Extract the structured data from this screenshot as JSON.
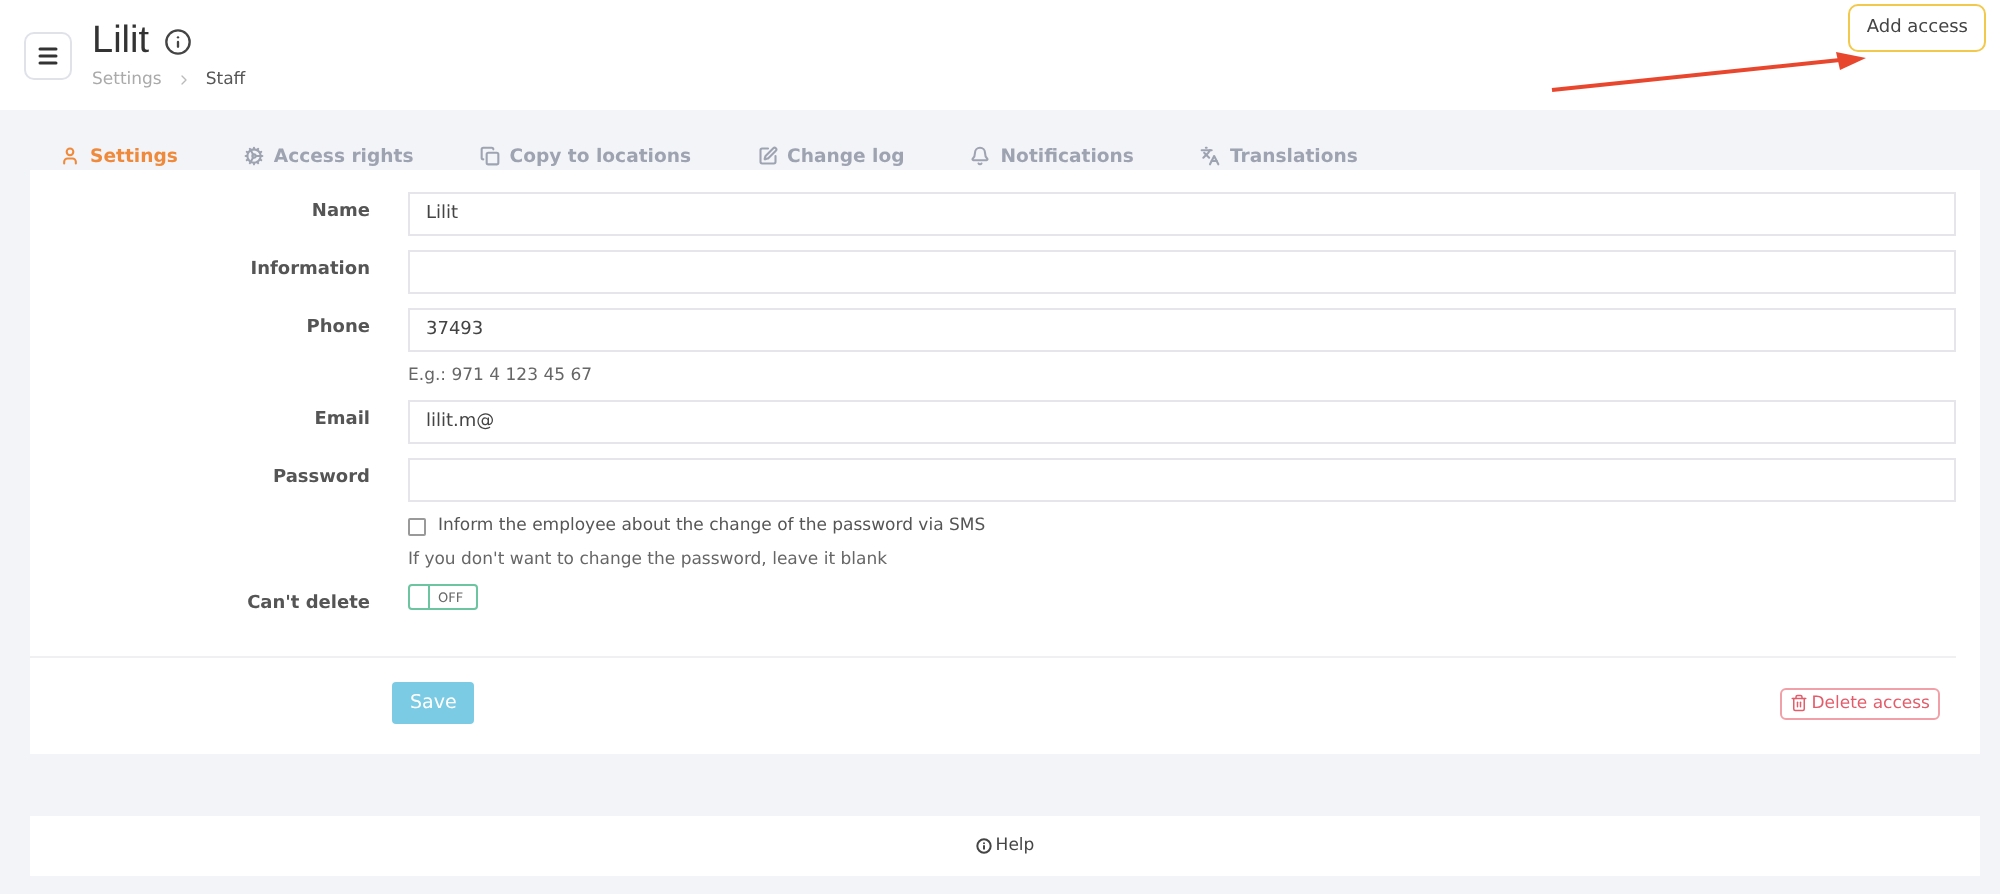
{
  "header": {
    "title": "Lilit",
    "breadcrumbs": [
      {
        "label": "Settings",
        "current": false
      },
      {
        "label": "Staff",
        "current": true
      }
    ],
    "add_button": "Add access"
  },
  "tabs": [
    {
      "label": "Settings",
      "selected": true
    },
    {
      "label": "Access rights",
      "selected": false
    },
    {
      "label": "Copy to locations",
      "selected": false
    },
    {
      "label": "Change log",
      "selected": false
    },
    {
      "label": "Notifications",
      "selected": false
    },
    {
      "label": "Translations",
      "selected": false
    }
  ],
  "form": {
    "fields": [
      {
        "label": "Name",
        "kind": "input",
        "value": "Lilit"
      },
      {
        "label": "Information",
        "kind": "input"
      },
      {
        "label": "Phone",
        "kind": "input",
        "value": "37493",
        "hint": "E.g.: 971 4 123 45 67"
      },
      {
        "label": "Email",
        "kind": "input",
        "value": "lilit.m@"
      },
      {
        "label": "Password",
        "kind": "input",
        "checkbox": {
          "label": "Inform the employee about the change of the password via SMS",
          "checked": false
        },
        "hint": "If you don't want to change the password, leave it blank"
      },
      {
        "label": "Can't delete",
        "kind": "toggle",
        "on": false,
        "toggle_text": "OFF"
      }
    ],
    "save": "Save",
    "delete": "Delete access"
  },
  "footer": {
    "help": "Help"
  }
}
